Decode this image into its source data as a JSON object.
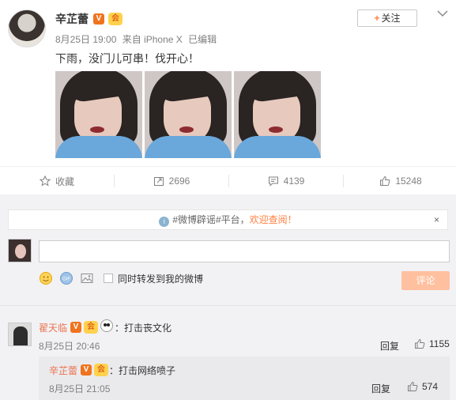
{
  "post": {
    "author": "辛芷蕾",
    "v_badge": "V",
    "vip_badge": "会",
    "date": "8月25日 19:00",
    "source": "来自 iPhone X",
    "edited": "已编辑",
    "follow_label": "关注",
    "follow_plus": "+",
    "text": "下雨，没门儿可串！伐开心！",
    "images": [
      "photo-1",
      "photo-2",
      "photo-3"
    ]
  },
  "actions": {
    "favorite": "收藏",
    "repost_count": "2696",
    "comment_count": "4139",
    "like_count": "15248"
  },
  "notice": {
    "prefix": "#微博辟谣#平台，",
    "link": "欢迎查阅！",
    "close": "×",
    "info_glyph": "i"
  },
  "composer": {
    "input_value": "",
    "repost_checkbox_label": "同时转发到我的微博",
    "submit_label": "评论"
  },
  "comments": [
    {
      "author": "翟天临",
      "v_badge": "V",
      "vip_badge": "会",
      "text": "：打击丧文化",
      "date": "8月25日 20:46",
      "reply_label": "回复",
      "likes": "1155",
      "sub_reply": {
        "author": "辛芷蕾",
        "v_badge": "V",
        "vip_badge": "会",
        "text": "：打击网络喷子",
        "date": "8月25日 21:05",
        "reply_label": "回复",
        "likes": "574"
      }
    }
  ],
  "colors": {
    "accent": "#ff8140",
    "username_link": "#eb7350",
    "meta_gray": "#808080",
    "background_gray": "#f2f2f5",
    "submit_disabled": "#ffc09f"
  }
}
